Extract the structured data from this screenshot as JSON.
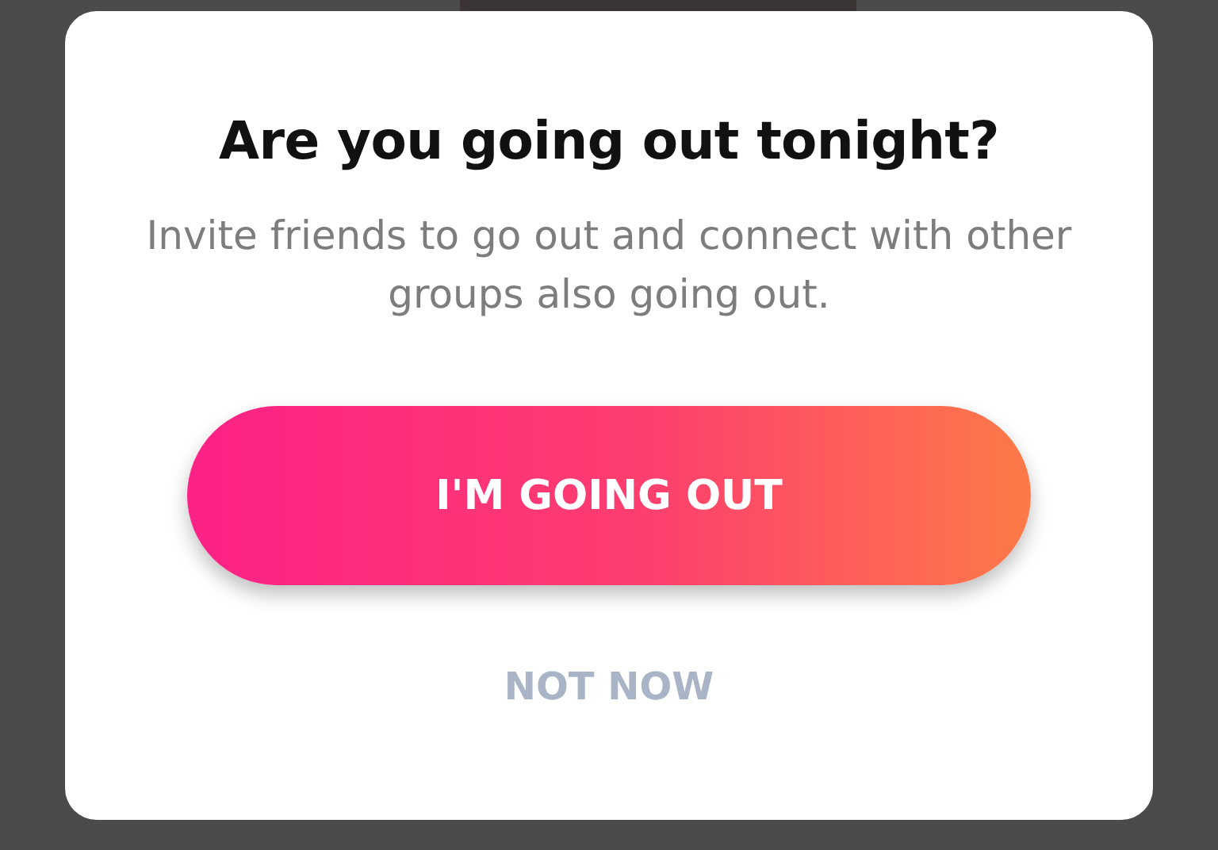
{
  "dialog": {
    "title": "Are you going out tonight?",
    "message": "Invite friends to go out and connect with other groups also going out.",
    "primary_button": "I'M GOING OUT",
    "secondary_button": "NOT NOW"
  }
}
